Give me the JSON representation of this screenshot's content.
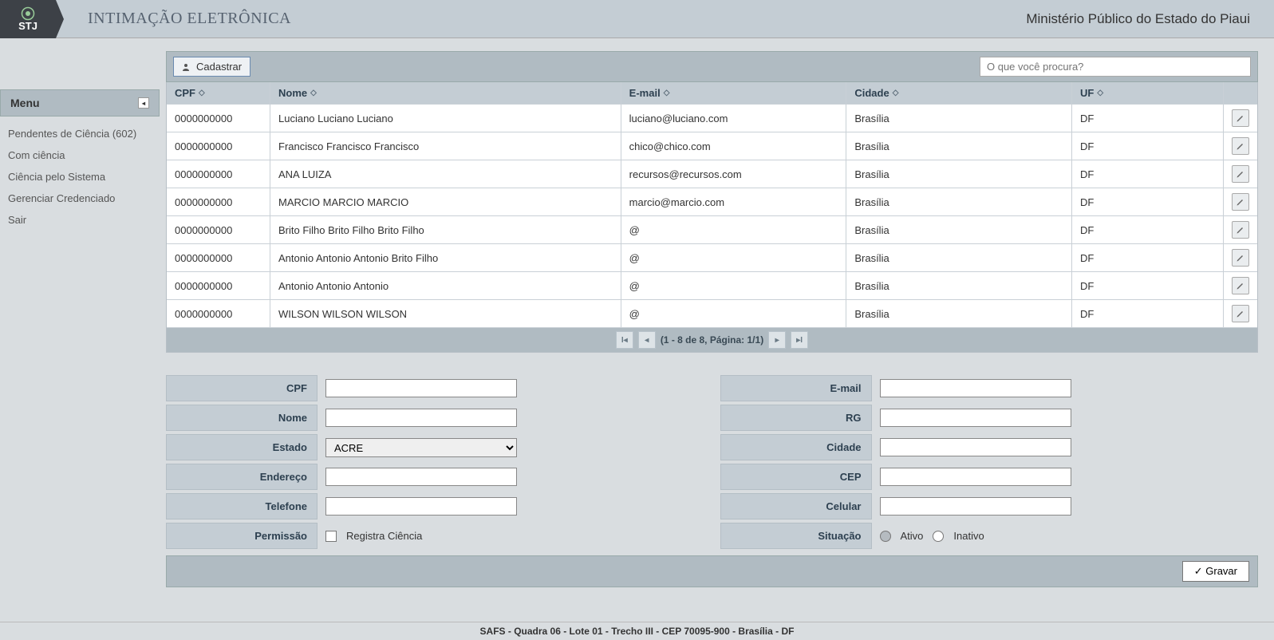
{
  "header": {
    "logo": "STJ",
    "title": "INTIMAÇÃO ELETRÔNICA",
    "subtitle": "Ministério Público do Estado do Piaui"
  },
  "menu": {
    "title": "Menu",
    "items": [
      {
        "label": "Pendentes de Ciência (602)"
      },
      {
        "label": "Com ciência"
      },
      {
        "label": "Ciência pelo Sistema"
      },
      {
        "label": "Gerenciar Credenciado"
      },
      {
        "label": "Sair"
      }
    ]
  },
  "toolbar": {
    "cadastrar": "Cadastrar",
    "search_placeholder": "O que você procura?"
  },
  "columns": {
    "cpf": "CPF",
    "nome": "Nome",
    "email": "E-mail",
    "cidade": "Cidade",
    "uf": "UF"
  },
  "rows": [
    {
      "cpf": "0000000000",
      "nome": "Luciano Luciano Luciano",
      "email": "luciano@luciano.com",
      "cidade": "Brasília",
      "uf": "DF"
    },
    {
      "cpf": "0000000000",
      "nome": "Francisco Francisco Francisco",
      "email": "chico@chico.com",
      "cidade": "Brasília",
      "uf": "DF"
    },
    {
      "cpf": "0000000000",
      "nome": "ANA LUIZA",
      "email": "recursos@recursos.com",
      "cidade": "Brasília",
      "uf": "DF"
    },
    {
      "cpf": "0000000000",
      "nome": "MARCIO  MARCIO  MARCIO",
      "email": "marcio@marcio.com",
      "cidade": "Brasília",
      "uf": "DF"
    },
    {
      "cpf": "0000000000",
      "nome": "Brito Filho Brito Filho Brito Filho",
      "email": "@",
      "cidade": "Brasília",
      "uf": "DF"
    },
    {
      "cpf": "0000000000",
      "nome": "Antonio Antonio Antonio Brito Filho",
      "email": "@",
      "cidade": "Brasília",
      "uf": "DF"
    },
    {
      "cpf": "0000000000",
      "nome": "Antonio Antonio Antonio",
      "email": "@",
      "cidade": "Brasília",
      "uf": "DF"
    },
    {
      "cpf": "0000000000",
      "nome": "WILSON  WILSON  WILSON",
      "email": "@",
      "cidade": "Brasília",
      "uf": "DF"
    }
  ],
  "paginator": "(1 - 8 de 8, Página: 1/1)",
  "form": {
    "labels": {
      "cpf": "CPF",
      "nome": "Nome",
      "estado": "Estado",
      "endereco": "Endereço",
      "telefone": "Telefone",
      "permissao": "Permissão",
      "email": "E-mail",
      "rg": "RG",
      "cidade": "Cidade",
      "cep": "CEP",
      "celular": "Celular",
      "situacao": "Situação"
    },
    "estado_value": "ACRE",
    "permissao_checkbox": "Registra Ciência",
    "situacao_ativo": "Ativo",
    "situacao_inativo": "Inativo"
  },
  "actions": {
    "gravar": "Gravar"
  },
  "footer": "SAFS - Quadra 06 - Lote 01 - Trecho III - CEP 70095-900 - Brasília - DF"
}
